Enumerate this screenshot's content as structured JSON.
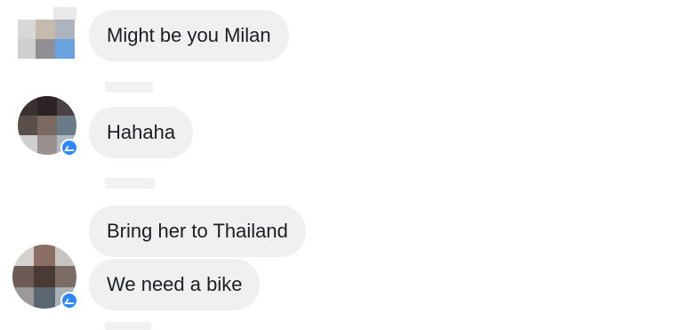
{
  "conversation": {
    "messages": [
      {
        "text": "Might be you Milan"
      },
      {
        "text": "Hahaha"
      },
      {
        "text": "Bring her to Thailand"
      },
      {
        "text": "We need a bike"
      }
    ]
  },
  "colors": {
    "bubble_background": "#f1f0f0",
    "bubble_text": "#1c1e21",
    "messenger_badge": "#2d88ff"
  }
}
